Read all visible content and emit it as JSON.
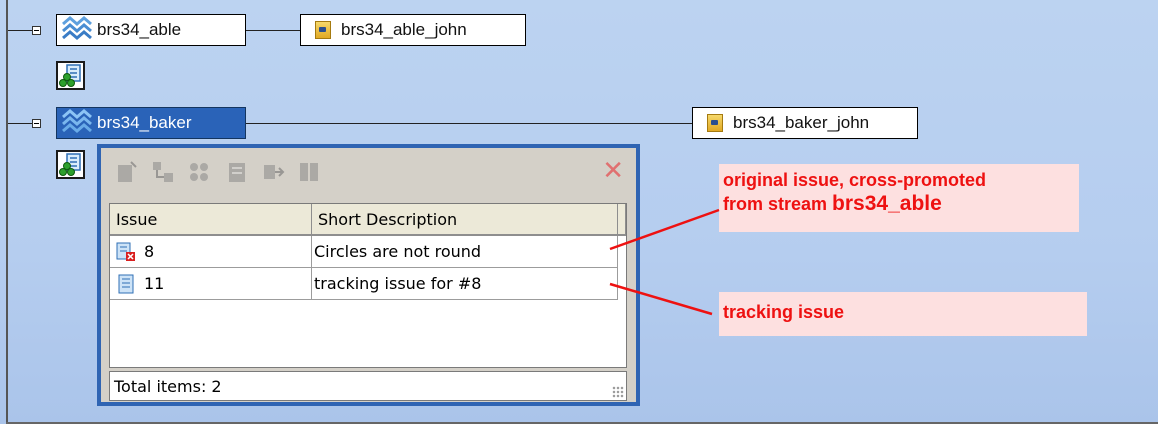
{
  "tree": {
    "streams": [
      {
        "name": "brs34_able",
        "workspace": "brs34_able_john",
        "selected": false
      },
      {
        "name": "brs34_baker",
        "workspace": "brs34_baker_john",
        "selected": true
      }
    ]
  },
  "issues_panel": {
    "close_label": "✕",
    "columns": [
      "Issue",
      "Short Description"
    ],
    "rows": [
      {
        "issue": "8",
        "description": "Circles are not round",
        "icon": "issue-cross-promoted-icon"
      },
      {
        "issue": "11",
        "description": "tracking issue for #8",
        "icon": "issue-icon"
      }
    ],
    "status": "Total items: 2"
  },
  "annotations": {
    "original_line1": "original issue, cross-promoted",
    "original_line2_prefix": "from stream ",
    "original_line2_stream": "brs34_able",
    "tracking": "tracking issue"
  },
  "colors": {
    "annotation_text": "#ee1111",
    "annotation_bg": "#fde0e0",
    "selection": "#2a63b8",
    "background": "#bcd3f1"
  }
}
